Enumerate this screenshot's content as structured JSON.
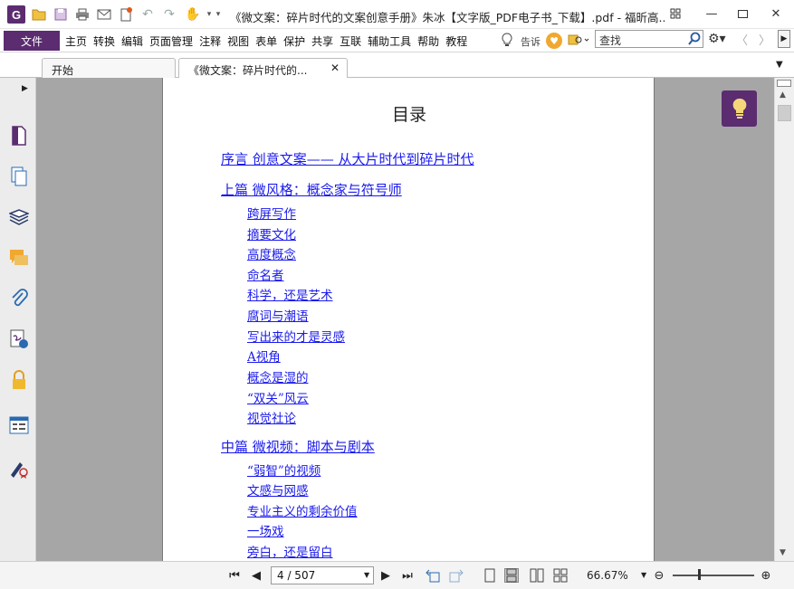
{
  "window": {
    "title": "《微文案：碎片时代的文案创意手册》朱冰【文字版_PDF电子书_下载】.pdf - 福昕高...",
    "app_logo": "G"
  },
  "menu": {
    "file": "文件",
    "items": [
      "主页",
      "转换",
      "编辑",
      "页面管理",
      "注释",
      "视图",
      "表单",
      "保护",
      "共享",
      "互联",
      "辅助工具",
      "帮助",
      "教程"
    ],
    "tell_me": "告诉",
    "search_placeholder": "查找"
  },
  "tabs": [
    {
      "label": "开始"
    },
    {
      "label": "《微文案：碎片时代的..."
    }
  ],
  "toc": {
    "title": "目录",
    "entries": [
      {
        "text": "序言 创意文案—— 从大片时代到碎片时代",
        "level": "major"
      },
      {
        "text": "上篇 微风格：概念家与符号师",
        "level": "major"
      },
      {
        "text": "跨屏写作",
        "level": "minor"
      },
      {
        "text": "摘要文化",
        "level": "minor"
      },
      {
        "text": "高度概念",
        "level": "minor"
      },
      {
        "text": "命名者",
        "level": "minor"
      },
      {
        "text": "科学，还是艺术",
        "level": "minor"
      },
      {
        "text": "腐词与潮语",
        "level": "minor"
      },
      {
        "text": "写出来的才是灵感",
        "level": "minor"
      },
      {
        "text": "A视角",
        "level": "minor"
      },
      {
        "text": "概念是湿的",
        "level": "minor"
      },
      {
        "text": "“双关”风云",
        "level": "minor"
      },
      {
        "text": "视觉社论",
        "level": "minor"
      },
      {
        "text": "中篇 微视频：脚本与剧本",
        "level": "major"
      },
      {
        "text": "“弱智”的视频",
        "level": "minor"
      },
      {
        "text": "文感与网感",
        "level": "minor"
      },
      {
        "text": "专业主义的剩余价值",
        "level": "minor"
      },
      {
        "text": "一场戏",
        "level": "minor"
      },
      {
        "text": "旁白，还是留白",
        "level": "minor"
      }
    ]
  },
  "statusbar": {
    "page": "4 / 507",
    "zoom": "66.67%"
  },
  "colors": {
    "brand": "#5b2c6f",
    "link": "#1a1aee",
    "canvas": "#a6a6a6"
  }
}
